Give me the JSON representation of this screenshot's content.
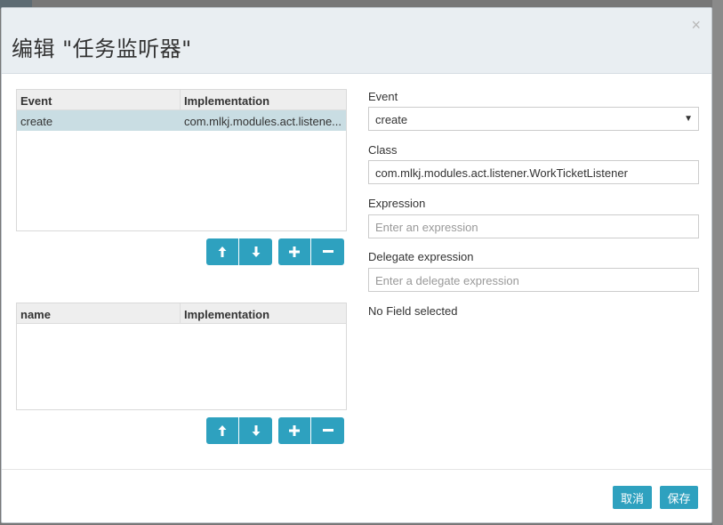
{
  "dialog": {
    "title": "编辑 \"任务监听器\"",
    "close_glyph": "×"
  },
  "listener_grid": {
    "columns": [
      "Event",
      "Implementation"
    ],
    "rows": [
      {
        "event": "create",
        "implementation": "com.mlkj.modules.act.listene..."
      }
    ]
  },
  "field_grid": {
    "columns": [
      "name",
      "Implementation"
    ],
    "rows": []
  },
  "toolbar_icons": [
    "arrow-up-icon",
    "arrow-down-icon",
    "plus-icon",
    "minus-icon"
  ],
  "form": {
    "event_label": "Event",
    "event_value": "create",
    "class_label": "Class",
    "class_value": "com.mlkj.modules.act.listener.WorkTicketListener",
    "expression_label": "Expression",
    "expression_placeholder": "Enter an expression",
    "delegate_label": "Delegate expression",
    "delegate_placeholder": "Enter a delegate expression",
    "no_field_text": "No Field selected"
  },
  "footer": {
    "cancel_label": "取消",
    "save_label": "保存"
  },
  "colors": {
    "accent": "#2ea1bf",
    "selected_row": "#c9dde3",
    "header_bg": "#e9eef2"
  }
}
